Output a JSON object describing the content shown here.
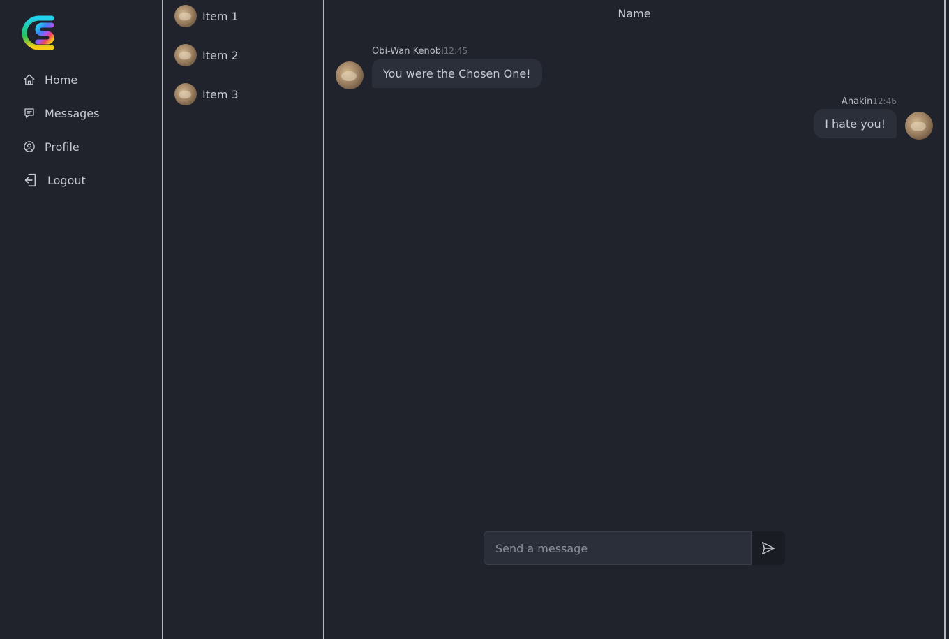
{
  "sidebar": {
    "logo": "gradient-s-logo",
    "items": [
      {
        "label": "Home",
        "icon": "home-icon"
      },
      {
        "label": "Messages",
        "icon": "chat-bubble-icon"
      },
      {
        "label": "Profile",
        "icon": "user-circle-icon"
      },
      {
        "label": "Logout",
        "icon": "logout-icon"
      }
    ]
  },
  "conversations": {
    "items": [
      {
        "label": "Item 1"
      },
      {
        "label": "Item 2"
      },
      {
        "label": "Item 3"
      }
    ]
  },
  "chat": {
    "title": "Name",
    "messages": [
      {
        "sender": "Obi-Wan Kenobi",
        "time": "12:45",
        "text": "You were the Chosen One!",
        "direction": "incoming"
      },
      {
        "sender": "Anakin",
        "time": "12:46",
        "text": "I hate you!",
        "direction": "outgoing"
      }
    ],
    "composer": {
      "placeholder": "Send a message",
      "value": ""
    }
  },
  "colors": {
    "background": "#20232c",
    "bubble": "#2b2f3a",
    "divider": "#b4b8c0",
    "text": "#c6c9d1",
    "muted": "#6f7480"
  }
}
